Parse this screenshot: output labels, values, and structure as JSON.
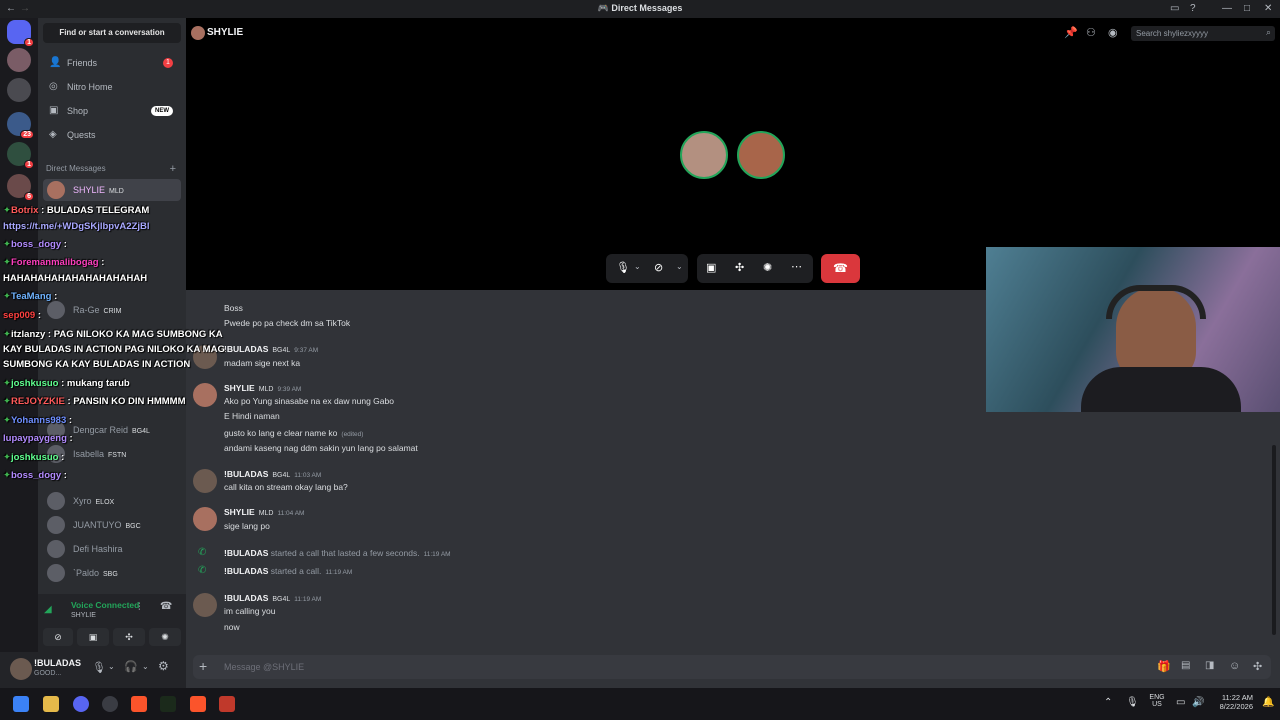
{
  "window": {
    "title": "Direct Messages"
  },
  "sidebar": {
    "find_label": "Find or start a conversation",
    "nav": [
      {
        "label": "Friends",
        "icon": "friends-icon",
        "badge": "1"
      },
      {
        "label": "Nitro Home",
        "icon": "nitro-icon"
      },
      {
        "label": "Shop",
        "icon": "shop-icon",
        "badge_new": "NEW"
      },
      {
        "label": "Quests",
        "icon": "quests-icon"
      }
    ],
    "dm_header": "Direct Messages",
    "dms": [
      {
        "name": "SHYLIE",
        "tag": "MLD"
      },
      {
        "name": "Ra-Ge",
        "tag": "CRIM"
      },
      {
        "name": "Dengcar Reid",
        "tag": "BG4L"
      },
      {
        "name": "Isabella",
        "tag": "FSTN"
      },
      {
        "name": "Xyro",
        "tag": "ELOX"
      },
      {
        "name": "JUANTUYO",
        "tag": "BGC"
      },
      {
        "name": "Defi Hashira",
        "tag": ""
      },
      {
        "name": "`Paldo",
        "tag": "SBG"
      }
    ]
  },
  "voice": {
    "status": "Voice Connected",
    "channel": "SHYLIE"
  },
  "user": {
    "name": "!BULADAS",
    "status": "GOOD..."
  },
  "servers": {
    "badges": [
      "1",
      "23",
      "1",
      "6"
    ]
  },
  "chat": {
    "header_name": "SHYLIE",
    "search_placeholder": "Search shyliezxyyyy",
    "input_placeholder": "Message @SHYLIE",
    "messages": [
      {
        "text": "Boss"
      },
      {
        "text": "Pwede po pa check dm sa TikTok"
      },
      {
        "name": "!BULADAS",
        "tag": "BG4L",
        "time": "9:37 AM",
        "text": "madam sige next ka"
      },
      {
        "name": "SHYLIE",
        "tag": "MLD",
        "time": "9:39 AM",
        "text": "Ako po Yung sinasabe na ex daw nung Gabo"
      },
      {
        "text": "E Hindi naman"
      },
      {
        "text": "gusto ko lang e clear name ko",
        "edited": "(edited)"
      },
      {
        "text": "andami kaseng nag ddm sakin yun lang po salamat"
      },
      {
        "name": "!BULADAS",
        "tag": "BG4L",
        "time": "11:03 AM",
        "text": "call kita on stream okay lang ba?"
      },
      {
        "name": "SHYLIE",
        "tag": "MLD",
        "time": "11:04 AM",
        "text": "sige lang po"
      },
      {
        "name": "!BULADAS",
        "sys": "started a call that lasted a few seconds.",
        "time": "11:19 AM"
      },
      {
        "name": "!BULADAS",
        "sys": "started a call.",
        "time": "11:19 AM"
      },
      {
        "name": "!BULADAS",
        "tag": "BG4L",
        "time": "11:19 AM",
        "text": "im calling you"
      },
      {
        "text": "now"
      }
    ]
  },
  "overlay": {
    "lines": [
      {
        "user": "Botrix",
        "msg": ": BULADAS TELEGRAM"
      },
      {
        "user": "",
        "msg": "https://t.me/+WDgSKjlbpvA2ZjBl"
      },
      {
        "user": "boss_dogy",
        "msg": ":"
      },
      {
        "user": "Foremanmalibogag",
        "msg": ":"
      },
      {
        "user": "",
        "msg": "HAHAHAHAHAHAHAHAHAHAH"
      },
      {
        "user": "TeaMang",
        "msg": ":"
      },
      {
        "user": "sep009",
        "msg": ":"
      },
      {
        "user": "itzlanzy",
        "msg": ": PAG NILOKO KA MAG SUMBONG KA"
      },
      {
        "user": "",
        "msg": "KAY BULADAS IN ACTION PAG NILOKO KA MAG"
      },
      {
        "user": "",
        "msg": "SUMBONG KA KAY BULADAS IN ACTION"
      },
      {
        "user": "joshkusuo",
        "msg": ": mukang tarub"
      },
      {
        "user": "REJOYZKIE",
        "msg": ": PANSIN KO DIN HMMMM"
      },
      {
        "user": "Yohanns983",
        "msg": ":"
      },
      {
        "user": "lupaypaygeng",
        "msg": ":"
      },
      {
        "user": "joshkusuo",
        "msg": ":"
      },
      {
        "user": "boss_dogy",
        "msg": ":"
      }
    ]
  },
  "taskbar": {
    "lang": "ENG",
    "region": "US",
    "time": "11:22 AM",
    "date": "8/22/2026"
  },
  "colors": {
    "accent": "#5865f2",
    "danger": "#da373c",
    "online": "#23a55a"
  }
}
